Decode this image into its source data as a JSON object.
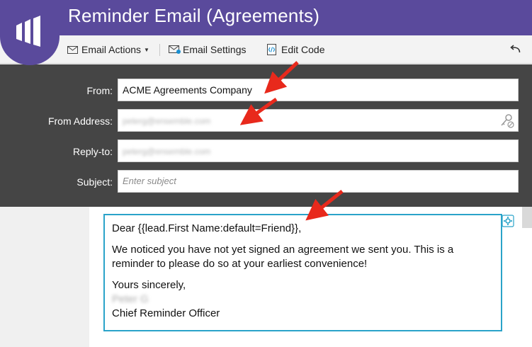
{
  "window": {
    "title": "Reminder Email (Agreements)"
  },
  "toolbar": {
    "email_actions_label": "Email Actions",
    "email_settings_label": "Email Settings",
    "edit_code_label": "Edit Code"
  },
  "form": {
    "from_label": "From:",
    "from_value": "ACME Agreements Company",
    "from_address_label": "From Address:",
    "from_address_value": "peterg@ensemble.com",
    "reply_to_label": "Reply-to:",
    "reply_to_value": "peterg@ensemble.com",
    "subject_label": "Subject:",
    "subject_placeholder": "Enter subject"
  },
  "email_body": {
    "greeting": "Dear {{lead.First Name:default=Friend}},",
    "paragraph": "We noticed you have not yet signed an agreement we sent you. This is a reminder to please do so at your earliest convenience!",
    "closing": "Yours sincerely,",
    "signer_name": "Peter G",
    "signer_title": "Chief Reminder Officer"
  },
  "colors": {
    "brand": "#5a4a9c",
    "panel": "#454545",
    "editor_border": "#2aa3c9",
    "annotation_arrow": "#e8291c"
  }
}
